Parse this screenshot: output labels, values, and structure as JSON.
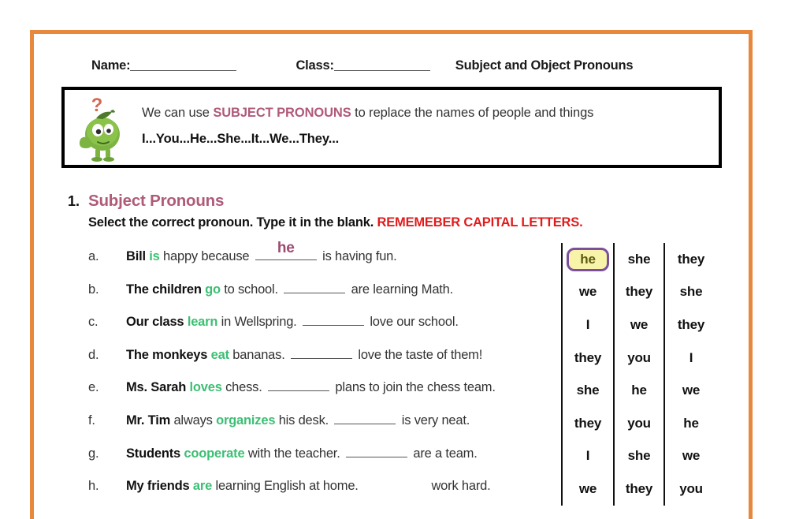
{
  "theme": {
    "frame_color": "#e8883c",
    "accent_mauve": "#b05a7a",
    "verb_green": "#3cbf73",
    "warn_red": "#e01b1b",
    "answer_purple": "#9c4a6e",
    "selected_fill": "#f7f3a8",
    "selected_border": "#7c4f9c"
  },
  "header": {
    "name_label": "Name:",
    "class_label": "Class:",
    "worksheet_title": "Subject and Object Pronouns"
  },
  "tip_box": {
    "mascot_icon": "green-monster-thinking-icon",
    "question_mark": "?",
    "line1_before": "We can use ",
    "line1_accent": "SUBJECT PRONOUNS",
    "line1_after": " to replace the names of people and things",
    "line2": "I...You...He...She...It...We...They..."
  },
  "section": {
    "number": "1.",
    "title": "Subject Pronouns",
    "instructions_plain": "Select the correct pronoun. Type it in the blank. ",
    "instructions_warn": "REMEMEBER CAPITAL LETTERS."
  },
  "questions": [
    {
      "letter": "a.",
      "subject": "Bill",
      "verb": "is",
      "mid": " happy because ",
      "typed_answer": "he",
      "tail": " is having fun.",
      "blank_visible": true
    },
    {
      "letter": "b.",
      "subject": "The children",
      "verb": "go",
      "mid": " to school. ",
      "typed_answer": "",
      "tail": " are learning Math.",
      "blank_visible": true
    },
    {
      "letter": "c.",
      "subject": "Our class",
      "verb": "learn",
      "mid": " in Wellspring. ",
      "typed_answer": "",
      "tail": " love our school.",
      "blank_visible": true
    },
    {
      "letter": "d.",
      "subject": "The monkeys",
      "verb": "eat",
      "mid": " bananas. ",
      "typed_answer": "",
      "tail": " love the taste of them!",
      "blank_visible": true
    },
    {
      "letter": "e.",
      "subject": "Ms. Sarah",
      "verb": "loves",
      "mid": " chess. ",
      "typed_answer": "",
      "tail": " plans to join the chess team.",
      "blank_visible": true
    },
    {
      "letter": "f.",
      "subject": "Mr. Tim",
      "verb": "organizes",
      "mid": " his desk. ",
      "typed_answer": "",
      "tail": " is very neat.",
      "blank_visible": true,
      "pre_verb": " always "
    },
    {
      "letter": "g.",
      "subject": "Students",
      "verb": "cooperate",
      "mid": " with the teacher. ",
      "typed_answer": "",
      "tail": " are a team.",
      "blank_visible": true
    },
    {
      "letter": "h.",
      "subject": "My friends",
      "verb": "are",
      "mid": " learning English at home. ",
      "typed_answer": "",
      "tail": " work hard.",
      "blank_visible": false
    }
  ],
  "choice_grid": {
    "columns": 3,
    "selected": {
      "row": 0,
      "col": 0,
      "value": "he"
    },
    "rows": [
      [
        "he",
        "she",
        "they"
      ],
      [
        "we",
        "they",
        "she"
      ],
      [
        "I",
        "we",
        "they"
      ],
      [
        "they",
        "you",
        "I"
      ],
      [
        "she",
        "he",
        "we"
      ],
      [
        "they",
        "you",
        "he"
      ],
      [
        "I",
        "she",
        "we"
      ],
      [
        "we",
        "they",
        "you"
      ]
    ]
  }
}
